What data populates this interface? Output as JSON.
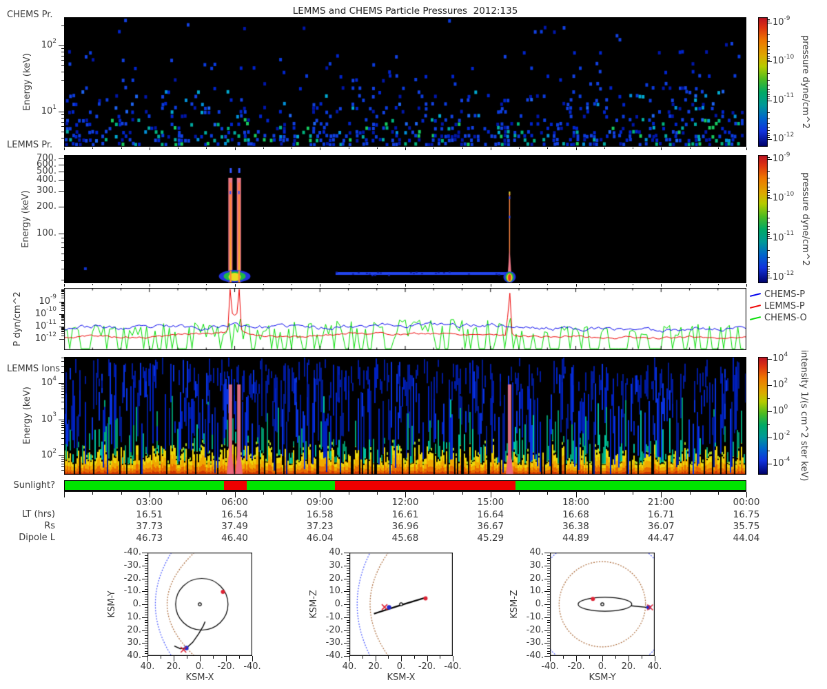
{
  "title": "LEMMS and CHEMS Particle Pressures  2012:135",
  "panels": {
    "chems": {
      "label": "CHEMS Pr.",
      "ylabel": "Energy (keV)",
      "yticks": [
        {
          "text": "10^2",
          "kev": 100
        },
        {
          "text": "10^1",
          "kev": 10
        }
      ]
    },
    "lemms": {
      "label": "LEMMS Pr.",
      "ylabel": "Energy (keV)",
      "yticks": [
        "700.",
        "600.",
        "500.",
        "400.",
        "300.",
        "200.",
        "100."
      ]
    },
    "pressure": {
      "ylabel": "P dyn/cm^2",
      "yticks": [
        "10^-9",
        "10^-10",
        "10^-11",
        "10^-12"
      ],
      "legend": [
        {
          "label": "CHEMS-P",
          "color": "#0000ee"
        },
        {
          "label": "LEMMS-P",
          "color": "#ee0000"
        },
        {
          "label": "CHEMS-O",
          "color": "#00dd00"
        }
      ]
    },
    "ions": {
      "label": "LEMMS Ions",
      "ylabel": "Energy (keV)",
      "yticks": [
        "10^4",
        "10^3",
        "10^2"
      ]
    }
  },
  "colorbars": {
    "pressure": {
      "label": "pressure dyne/cm^2",
      "ticks": [
        "10^-9",
        "10^-10",
        "10^-11",
        "10^-12"
      ]
    },
    "intensity": {
      "label": "intensity 1/(s cm^2 ster keV)",
      "ticks": [
        "10^4",
        "10^2",
        "10^0",
        "10^-2",
        "10^-4"
      ]
    }
  },
  "sunlight": {
    "label": "Sunlight?",
    "green": "#00e400",
    "red": "#ee0000",
    "segments": [
      {
        "from_hr": 0.0,
        "to_hr": 5.62,
        "state": "green"
      },
      {
        "from_hr": 5.62,
        "to_hr": 6.42,
        "state": "red"
      },
      {
        "from_hr": 6.42,
        "to_hr": 9.53,
        "state": "green"
      },
      {
        "from_hr": 9.53,
        "to_hr": 15.88,
        "state": "red"
      },
      {
        "from_hr": 15.88,
        "to_hr": 24.0,
        "state": "green"
      }
    ]
  },
  "time_axis": {
    "labels": [
      "03:00",
      "06:00",
      "09:00",
      "12:00",
      "15:00",
      "18:00",
      "21:00",
      "00:00"
    ],
    "label_hours": [
      3,
      6,
      9,
      12,
      15,
      18,
      21,
      24
    ],
    "rows": [
      {
        "label": "LT (hrs)",
        "values": [
          "16.51",
          "16.54",
          "16.58",
          "16.61",
          "16.64",
          "16.68",
          "16.71",
          "16.75"
        ]
      },
      {
        "label": "Rs",
        "values": [
          "37.73",
          "37.49",
          "37.23",
          "36.96",
          "36.67",
          "36.38",
          "36.07",
          "35.75"
        ]
      },
      {
        "label": "Dipole L",
        "values": [
          "46.73",
          "46.40",
          "46.04",
          "45.68",
          "45.29",
          "44.89",
          "44.47",
          "44.04"
        ]
      }
    ]
  },
  "orbit_plots": [
    {
      "xlabel": "KSM-X",
      "ylabel": "KSM-Y",
      "xticks": [
        "40.",
        "20.",
        "0.",
        "-20.",
        "-40."
      ],
      "yticks": [
        "-40.",
        "-30.",
        "-20.",
        "-10.",
        "0.",
        "10.",
        "20.",
        "30.",
        "40."
      ]
    },
    {
      "xlabel": "KSM-X",
      "ylabel": "KSM-Z",
      "xticks": [
        "40.",
        "20.",
        "0.",
        "-20.",
        "-40."
      ],
      "yticks": [
        "40.",
        "30.",
        "20.",
        "10.",
        "0.",
        "-10.",
        "-20.",
        "-30.",
        "-40."
      ]
    },
    {
      "xlabel": "KSM-Y",
      "ylabel": "KSM-Z",
      "xticks": [
        "-40.",
        "-20.",
        "0.",
        "20.",
        "40."
      ],
      "yticks": [
        "40.",
        "30.",
        "20.",
        "10.",
        "0.",
        "-10.",
        "-20.",
        "-30.",
        "-40."
      ]
    }
  ],
  "chart_data": [
    {
      "type": "heatmap",
      "title": "CHEMS Pr.",
      "ylabel": "Energy (keV)",
      "y_scale": "log",
      "x_range_hours": [
        0,
        24
      ],
      "y_range_kev": [
        3,
        265
      ],
      "colorbar": {
        "label": "pressure dyne/cm^2",
        "scale": "log",
        "range_dyne_cm2": [
          1e-12,
          1e-09
        ]
      },
      "pattern": "sparse scattered pixels on black; mostly dark-blue (~1e-12) specks, density and brightness increasing toward low energies; cyan-green (~1e-11) specks below ~6 keV"
    },
    {
      "type": "heatmap",
      "title": "LEMMS Pr.",
      "ylabel": "Energy (keV)",
      "y_scale": "log",
      "x_range_hours": [
        0,
        24
      ],
      "y_range_kev": [
        28,
        750
      ],
      "colorbar": {
        "label": "pressure dyne/cm^2",
        "scale": "log",
        "range_dyne_cm2": [
          1e-12,
          1e-09
        ]
      },
      "features": [
        {
          "kind": "vertical spike",
          "time_hr": 5.85,
          "energy_kev": [
            28,
            420
          ],
          "value": "pink-red ~1e-9"
        },
        {
          "kind": "vertical spike",
          "time_hr": 6.15,
          "energy_kev": [
            28,
            420
          ],
          "value": "pink-red ~1e-9"
        },
        {
          "kind": "narrow vertical spike",
          "time_hr": 15.67,
          "energy_kev": [
            28,
            300
          ],
          "value": "orange-red up to ~1e-9"
        },
        {
          "kind": "horizontal band",
          "time_hr": [
            9.55,
            15.8
          ],
          "energy_kev": 30,
          "value": "blue ~1e-11"
        },
        {
          "kind": "speck",
          "time_hr": 0.7,
          "energy_kev": 32,
          "value": "blue"
        }
      ]
    },
    {
      "type": "line",
      "ylabel": "P dyn/cm^2",
      "y_scale": "log",
      "ylim_dyne_cm2": [
        3e-13,
        2e-09
      ],
      "x_hours_start": 0,
      "x_hours_step": 1,
      "series": [
        {
          "name": "CHEMS-P",
          "color": "#0000ee",
          "values": [
            8e-12,
            1.1e-11,
            7e-12,
            9e-12,
            1.1e-11,
            8e-12,
            1.5e-11,
            9e-12,
            1.2e-11,
            8e-12,
            1.1e-11,
            1.5e-11,
            1.2e-11,
            1.6e-11,
            1.2e-11,
            1.5e-11,
            9e-12,
            7e-12,
            8e-12,
            6e-12,
            7e-12,
            5e-12,
            8e-12,
            6e-12,
            9e-12
          ]
        },
        {
          "name": "LEMMS-P",
          "color": "#ee0000",
          "values": [
            1.2e-12,
            2e-12,
            1.5e-12,
            1.3e-12,
            2.5e-12,
            3e-12,
            4e-12,
            2e-12,
            1.5e-12,
            2e-12,
            3e-12,
            3e-12,
            2.5e-12,
            3e-12,
            2.5e-12,
            2.5e-12,
            2e-12,
            1.5e-12,
            1.8e-12,
            1.2e-12,
            1.5e-12,
            1.2e-12,
            1.5e-12,
            1.3e-12,
            1.5e-12
          ],
          "events": [
            {
              "time_hr": 5.85,
              "peak": 1e-08
            },
            {
              "time_hr": 6.0,
              "peak": 8e-11
            },
            {
              "time_hr": 6.15,
              "peak": 1e-08
            },
            {
              "time_hr": 15.67,
              "peak": 5e-09
            }
          ]
        },
        {
          "name": "CHEMS-O",
          "color": "#00dd00",
          "values": [
            5e-12,
            2e-11,
            8e-12,
            1e-11,
            3e-11,
            1.5e-11,
            2e-11,
            1e-11,
            2.5e-11,
            1.5e-11,
            4e-11,
            3e-11,
            3.5e-11,
            3e-11,
            4e-11,
            3e-11,
            5e-12,
            2e-11,
            8e-12,
            1.5e-11,
            5e-12,
            1e-11,
            2e-11,
            8e-12,
            2.5e-11
          ],
          "events": [
            {
              "time_hr": 6.2,
              "peak": 4e-11
            },
            {
              "time_hr": 15.67,
              "peak": 7e-11
            }
          ]
        }
      ],
      "legend_position": "right"
    },
    {
      "type": "heatmap",
      "title": "LEMMS Ions",
      "ylabel": "Energy (keV)",
      "y_scale": "log",
      "x_range_hours": [
        0,
        24
      ],
      "y_range_kev": [
        30,
        50000
      ],
      "colorbar": {
        "label": "intensity 1/(s cm^2 ster keV)",
        "scale": "log",
        "range": [
          1e-05,
          10000.0
        ]
      },
      "pattern": "dense vertical striations: yellow-orange band (~1e2-1e4) below ~100 keV, teal streaks to ~1e3 keV, blue streaks (~1e-2-1e-4) up to 1e4+ keV on black",
      "features": [
        {
          "kind": "pink vertical streak",
          "time_hr": 5.85
        },
        {
          "kind": "pink vertical streak",
          "time_hr": 6.15
        },
        {
          "kind": "pink vertical streak",
          "time_hr": 15.67
        }
      ]
    },
    {
      "type": "scatter",
      "name": "orbit KSM-X/KSM-Y",
      "xlabel": "KSM-X",
      "ylabel": "KSM-Y",
      "xlim": [
        40,
        -40
      ],
      "ylim": [
        -40,
        40
      ],
      "bow_shock": {
        "apex": 34,
        "coef": 130
      },
      "magnetopause": {
        "apex": 25,
        "coef": 77
      },
      "orbit_circle": {
        "cx": -1.5,
        "cy": 0,
        "r": 20
      },
      "saturn": {
        "x": 0,
        "y": 0
      },
      "red_dot": {
        "x": -17.6,
        "y": -9.6
      },
      "red_x": {
        "x": 12.5,
        "y": 35.2
      },
      "blue_dot": {
        "x": 10.3,
        "y": 33.9
      },
      "trajectory": [
        [
          19.5,
          32.3
        ],
        [
          15,
          34.4
        ],
        [
          10.3,
          33.9
        ],
        [
          5.5,
          29.5
        ],
        [
          1,
          23
        ],
        [
          -2.5,
          17
        ],
        [
          -4,
          13.5
        ]
      ]
    },
    {
      "type": "scatter",
      "name": "orbit KSM-X/KSM-Z",
      "xlabel": "KSM-X",
      "ylabel": "KSM-Z",
      "xlim": [
        40,
        -40
      ],
      "ylim": [
        40,
        -40
      ],
      "bow_shock": {
        "apex": 34,
        "coef": 160
      },
      "magnetopause": {
        "apex": 24,
        "coef": 114
      },
      "saturn": {
        "x": 0,
        "y": 0
      },
      "red_dot": {
        "x": -18.9,
        "y": 4.6
      },
      "red_x": {
        "x": 12.8,
        "y": -2.2
      },
      "blue_dot": {
        "x": 9.3,
        "y": -2.4
      },
      "trajectory": [
        [
          21,
          -7.3
        ],
        [
          0,
          -0.6
        ],
        [
          -20,
          5.5
        ]
      ]
    },
    {
      "type": "scatter",
      "name": "orbit KSM-Y/KSM-Z",
      "xlabel": "KSM-Y",
      "ylabel": "KSM-Z",
      "xlim": [
        -40,
        40
      ],
      "ylim": [
        40,
        -40
      ],
      "ring_r": 33,
      "shock_r": 53,
      "ellipse": {
        "cx": 2,
        "cy": 0,
        "ry": 20.5,
        "rz": 5.4
      },
      "saturn": {
        "x": 0,
        "y": 0
      },
      "red_dot": {
        "x": -7.2,
        "y": 4.2
      },
      "red_x": {
        "x": 36.5,
        "y": -2.4
      },
      "blue_dot": {
        "x": 35.3,
        "y": -2.4
      },
      "tail": [
        [
          22,
          -1.2
        ],
        [
          36,
          -2.6
        ]
      ]
    }
  ]
}
